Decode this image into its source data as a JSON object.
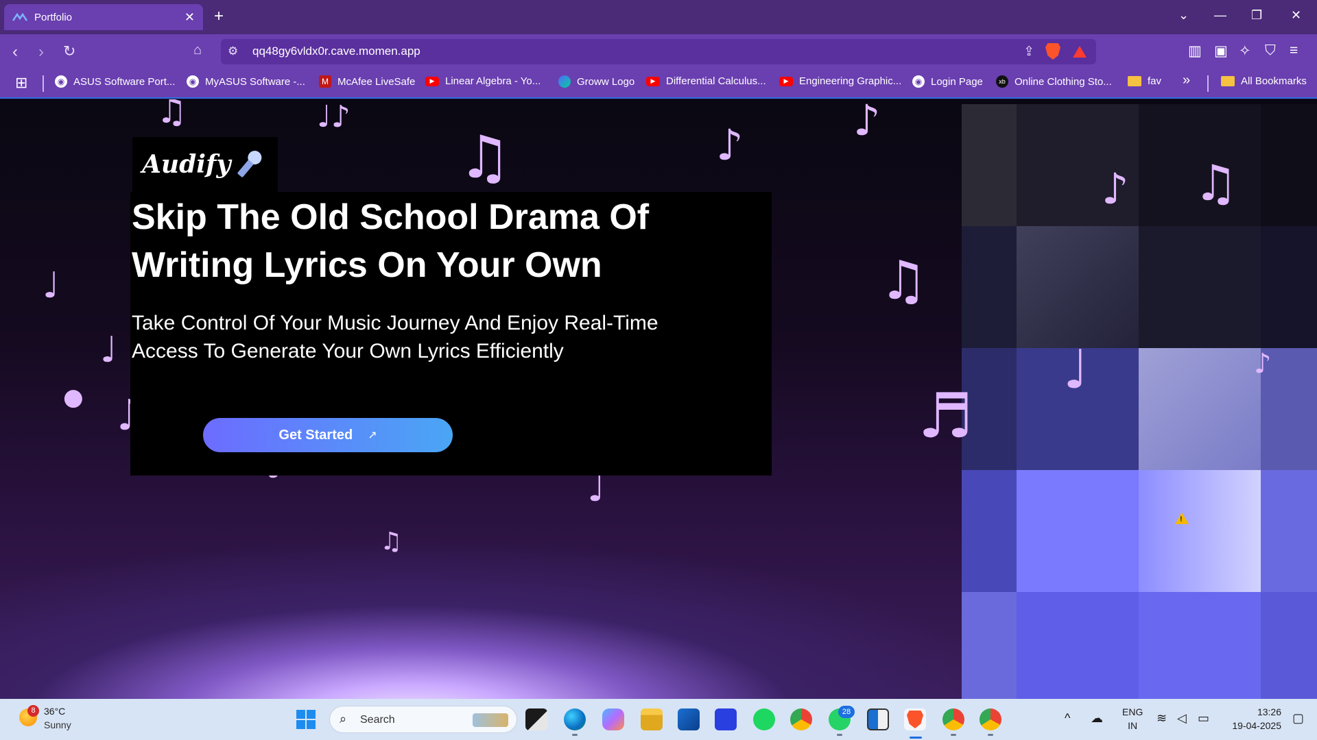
{
  "browser": {
    "tab_title": "Portfolio",
    "tab_close": "✕",
    "new_tab": "+",
    "url": "qq48gy6vldx0r.cave.momen.app"
  },
  "bookmarks": {
    "items": [
      {
        "label": "ASUS Software Port...",
        "icon": "globe-icon"
      },
      {
        "label": "MyASUS Software -...",
        "icon": "globe-icon"
      },
      {
        "label": "McAfee LiveSafe",
        "icon": "mcafee-icon"
      },
      {
        "label": "Linear Algebra - Yo...",
        "icon": "youtube-icon"
      },
      {
        "label": "Groww Logo",
        "icon": "groww-icon"
      },
      {
        "label": "Differential Calculus...",
        "icon": "youtube-icon"
      },
      {
        "label": "Engineering Graphic...",
        "icon": "youtube-icon"
      },
      {
        "label": "Login Page",
        "icon": "globe-icon"
      },
      {
        "label": "Online Clothing Sto...",
        "icon": "xb-icon"
      },
      {
        "label": "fav",
        "icon": "folder-icon"
      }
    ],
    "overflow": "»",
    "all_bookmarks": "All Bookmarks"
  },
  "page": {
    "logo": "Audify",
    "hero_title": "Skip The Old School Drama Of Writing Lyrics On Your Own",
    "hero_subtitle": "Take Control Of Your Music Journey And Enjoy Real-Time Access To Generate Your Own Lyrics Efficiently",
    "cta_label": "Get Started",
    "cta_arrow": "↗"
  },
  "taskbar": {
    "weather_badge": "8",
    "temperature": "36°C",
    "weather": "Sunny",
    "search_label": "Search",
    "whatsapp_badge": "28",
    "lang_line1": "ENG",
    "lang_line2": "IN",
    "time": "13:26",
    "date": "19-04-2025"
  },
  "colors": {
    "chrome_purple": "#6a3fb0",
    "tab_bar": "#4b2a78",
    "note_color": "#e0b8ff",
    "cta_start": "#6c6cff",
    "cta_end": "#4aa6f5"
  }
}
